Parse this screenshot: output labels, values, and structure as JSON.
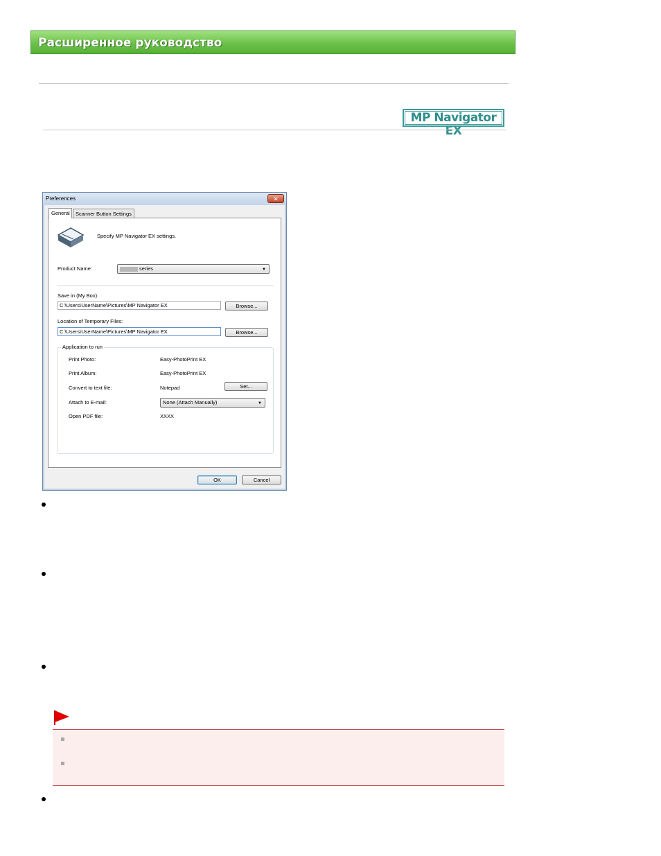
{
  "header": {
    "title": "Расширенное руководство"
  },
  "badge": {
    "label": "MP Navigator EX"
  },
  "dialog": {
    "title": "Preferences",
    "close_glyph": "✕",
    "tabs": [
      {
        "label": "General",
        "active": true
      },
      {
        "label": "Scanner Button Settings",
        "active": false
      }
    ],
    "intro": "Specify MP Navigator EX settings.",
    "product_name_label": "Product Name:",
    "product_name_value": "series",
    "save_in_label": "Save in (My Box):",
    "save_in_value": "C:\\Users\\UserName\\Pictures\\MP Navigator EX",
    "browse_label": "Browse...",
    "temp_label": "Location of Temporary Files:",
    "temp_value": "C:\\Users\\UserName\\Pictures\\MP Navigator EX",
    "group": {
      "label": "Application to run",
      "rows": [
        {
          "label": "Print Photo:",
          "value": "Easy-PhotoPrint EX"
        },
        {
          "label": "Print Album:",
          "value": "Easy-PhotoPrint EX"
        },
        {
          "label": "Convert to text file:",
          "value": "Notepad",
          "button": "Set..."
        },
        {
          "label": "Attach to E-mail:",
          "value": "None (Attach Manually)"
        },
        {
          "label": "Open PDF file:",
          "value": "XXXX"
        }
      ]
    },
    "ok_label": "OK",
    "cancel_label": "Cancel"
  },
  "colors": {
    "header_green": "#6cc24a",
    "badge_teal": "#3b9c9a",
    "note_red": "#c24a4a",
    "note_bg": "#fdeeee"
  },
  "icons": [
    "scanner-icon",
    "bullet-icon",
    "red-flag-icon",
    "square-bullet-icon",
    "close-icon",
    "dropdown-arrow-icon"
  ]
}
